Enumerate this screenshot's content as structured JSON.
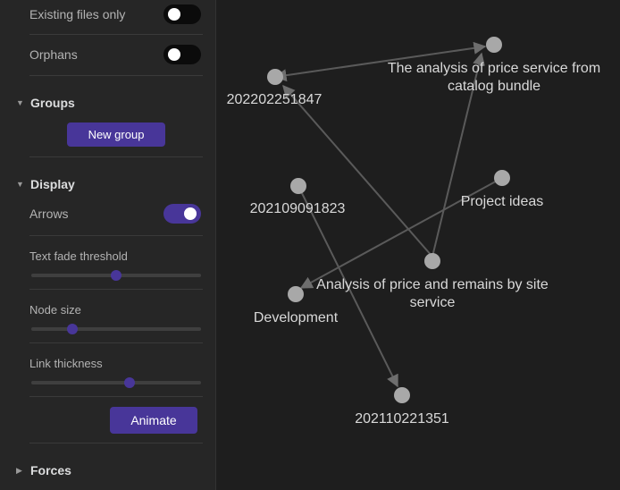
{
  "filters": {
    "existing_files_only_label": "Existing files only",
    "existing_files_only_on": false,
    "orphans_label": "Orphans",
    "orphans_on": false
  },
  "groups": {
    "title": "Groups",
    "new_group_label": "New group"
  },
  "display": {
    "title": "Display",
    "arrows_label": "Arrows",
    "arrows_on": true,
    "text_fade_label": "Text fade threshold",
    "text_fade_value": 0.5,
    "node_size_label": "Node size",
    "node_size_value": 0.24,
    "link_thickness_label": "Link thickness",
    "link_thickness_value": 0.58,
    "animate_label": "Animate"
  },
  "forces": {
    "title": "Forces"
  },
  "graph": {
    "colors": {
      "node": "#a8a8a8",
      "link": "#5a5a5a",
      "accent": "#483699"
    },
    "nodes": {
      "n202202251847": "202202251847",
      "nAnalysisCatalog": "The analysis of price service from catalog bundle",
      "nAnalysisCatalog_line1": "The analysis of price service from",
      "nAnalysisCatalog_line2": "catalog bundle",
      "n202109091823": "202109091823",
      "nProjectIdeas": "Project ideas",
      "nAnalysisSite_line1": "Analysis of price and remains by site",
      "nAnalysisSite_line2": "service",
      "nDevelopment": "Development",
      "n202110221351": "202110221351"
    }
  }
}
